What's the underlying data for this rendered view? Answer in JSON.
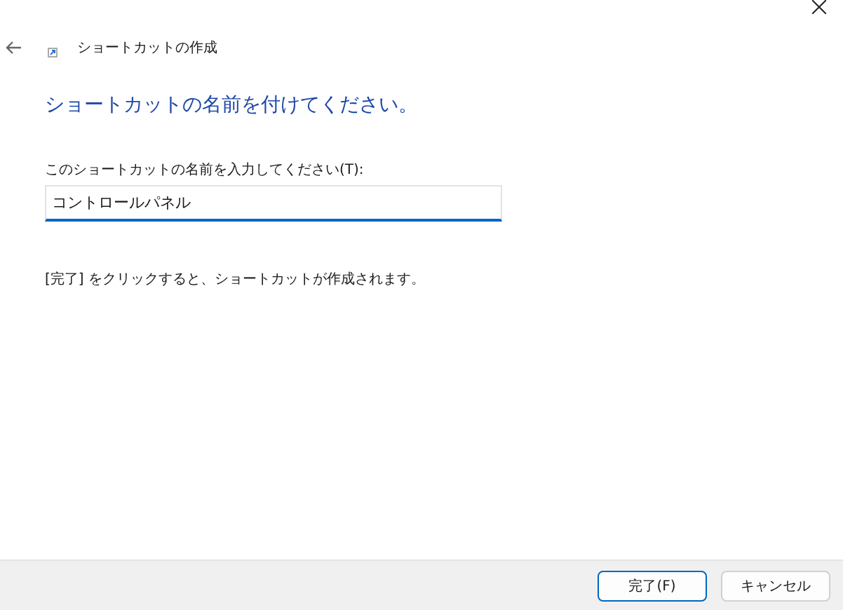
{
  "window": {
    "title": "ショートカットの作成"
  },
  "heading": "ショートカットの名前を付けてください。",
  "name_field": {
    "label": "このショートカットの名前を入力してください(T):",
    "value": "コントロールパネル"
  },
  "instruction": "[完了] をクリックすると、ショートカットが作成されます。",
  "buttons": [
    {
      "label": "完了(F)",
      "default": true
    },
    {
      "label": "キャンセル",
      "default": false
    }
  ]
}
